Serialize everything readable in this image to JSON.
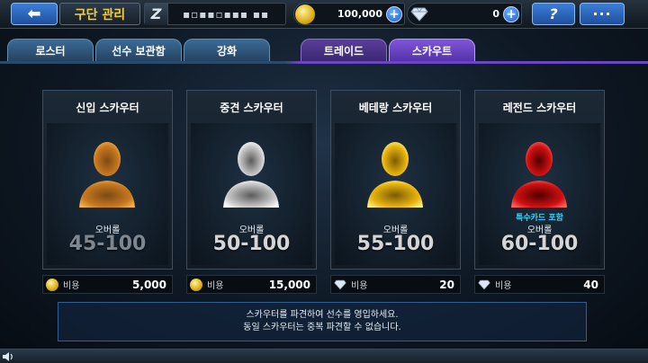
{
  "header": {
    "title": "구단 관리",
    "team_logo": "Z",
    "team_name": "▪▫▪▪▫▪▪▪ ▪▪",
    "gold": "100,000",
    "gems": "0",
    "help_label": "?",
    "more_label": "···"
  },
  "tabs": [
    {
      "label": "로스터"
    },
    {
      "label": "선수 보관함"
    },
    {
      "label": "강화"
    },
    {
      "label": "트레이드"
    },
    {
      "label": "스카우트"
    }
  ],
  "cards": [
    {
      "title": "신입 스카우터",
      "ovr_label": "오버롤",
      "range": "45-100",
      "cost_label": "비용",
      "cost": "5,000",
      "currency": "gold",
      "glow": "#c8781e"
    },
    {
      "title": "중견 스카우터",
      "ovr_label": "오버롤",
      "range": "50-100",
      "cost_label": "비용",
      "cost": "15,000",
      "currency": "gold",
      "glow": "#e8e8e8"
    },
    {
      "title": "베테랑 스카우터",
      "ovr_label": "오버롤",
      "range": "55-100",
      "cost_label": "비용",
      "cost": "20",
      "currency": "gem",
      "glow": "#e8b40e"
    },
    {
      "title": "레전드 스카우터",
      "special": "특수카드 포함",
      "ovr_label": "오버롤",
      "range": "60-100",
      "cost_label": "비용",
      "cost": "40",
      "currency": "gem",
      "glow": "#e01010"
    }
  ],
  "info": {
    "line1": "스카우터를 파견하여 선수를 영입하세요.",
    "line2": "동일 스카우터는 중복 파견할 수 없습니다."
  },
  "colors": {
    "accent_blue": "#3b7fd8",
    "tab_active": "#7f56d8",
    "gold_text": "#f3cd3a"
  }
}
